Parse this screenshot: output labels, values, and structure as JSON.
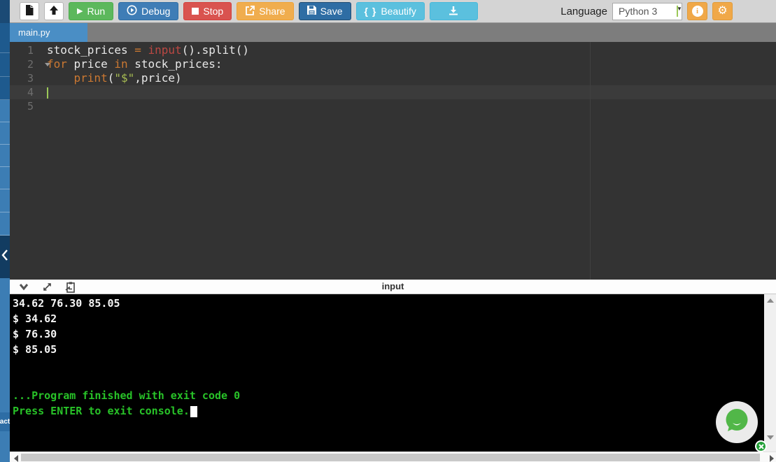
{
  "toolbar": {
    "run": "Run",
    "debug": "Debug",
    "stop": "Stop",
    "share": "Share",
    "save": "Save",
    "beautify": "Beautify",
    "beautify_icon": "{ }",
    "language_label": "Language",
    "language_value": "Python 3",
    "select_caret": "▼",
    "gear_glyph": "⚙"
  },
  "tabs": [
    {
      "label": "main.py",
      "active": true
    }
  ],
  "editor": {
    "cursor_line": 4,
    "folded_line": 2,
    "lines": [
      {
        "tokens": [
          {
            "t": "stock_prices ",
            "c": "plain"
          },
          {
            "t": "=",
            "c": "kw"
          },
          {
            "t": " ",
            "c": "plain"
          },
          {
            "t": "input",
            "c": "builtin"
          },
          {
            "t": "().split()",
            "c": "plain"
          }
        ]
      },
      {
        "tokens": [
          {
            "t": "for",
            "c": "kw"
          },
          {
            "t": " price ",
            "c": "plain"
          },
          {
            "t": "in",
            "c": "kw"
          },
          {
            "t": " stock_prices:",
            "c": "plain"
          }
        ]
      },
      {
        "tokens": [
          {
            "t": "    ",
            "c": "plain"
          },
          {
            "t": "print",
            "c": "kw"
          },
          {
            "t": "(",
            "c": "plain"
          },
          {
            "t": "\"$\"",
            "c": "str"
          },
          {
            "t": ",price)",
            "c": "plain"
          }
        ]
      },
      {
        "tokens": []
      },
      {
        "tokens": []
      }
    ]
  },
  "console": {
    "title": "input",
    "lines": [
      {
        "text": "34.62 76.30 85.05",
        "color": "white"
      },
      {
        "text": "$ 34.62",
        "color": "white"
      },
      {
        "text": "$ 76.30",
        "color": "white"
      },
      {
        "text": "$ 85.05",
        "color": "white"
      },
      {
        "text": "",
        "color": "white"
      },
      {
        "text": "",
        "color": "white"
      },
      {
        "text": "...Program finished with exit code 0",
        "color": "green"
      },
      {
        "text": "Press ENTER to exit console.",
        "color": "green",
        "cursor": true
      }
    ]
  },
  "sidebar": {
    "contact_fragment": "act"
  },
  "icons": {
    "new_file": "new-file-icon",
    "upload": "upload-icon",
    "play": "▶",
    "debug": "circled-play-icon",
    "stop": "square-icon",
    "share": "share-icon",
    "save": "floppy-icon",
    "download": "download-icon",
    "info": "i",
    "gear": "gear-icon",
    "collapse": "chevron-left-icon",
    "console_collapse": "chevron-down-icon",
    "console_expand": "expand-icon",
    "console_clipboard": "clipboard-icon",
    "chat": "chat-bubble-icon",
    "badge_close": "close-icon"
  },
  "colors": {
    "run_green": "#5cb85c",
    "debug_blue": "#3f7db6",
    "stop_red": "#d9534f",
    "share_orange": "#f0ad4e",
    "save_blue": "#2e6da4",
    "beautify_cyan": "#5bc0de",
    "accent_orange": "#f0a848",
    "tab_blue": "#4a8ec5",
    "sidebar_blue": "#3c7db4",
    "editor_bg": "#333333",
    "keyword": "#cb7832",
    "builtin_fn": "#bc4843",
    "string": "#a8bd53",
    "console_green": "#28c228",
    "console_bg": "#000000",
    "chat_green": "#51b748"
  }
}
